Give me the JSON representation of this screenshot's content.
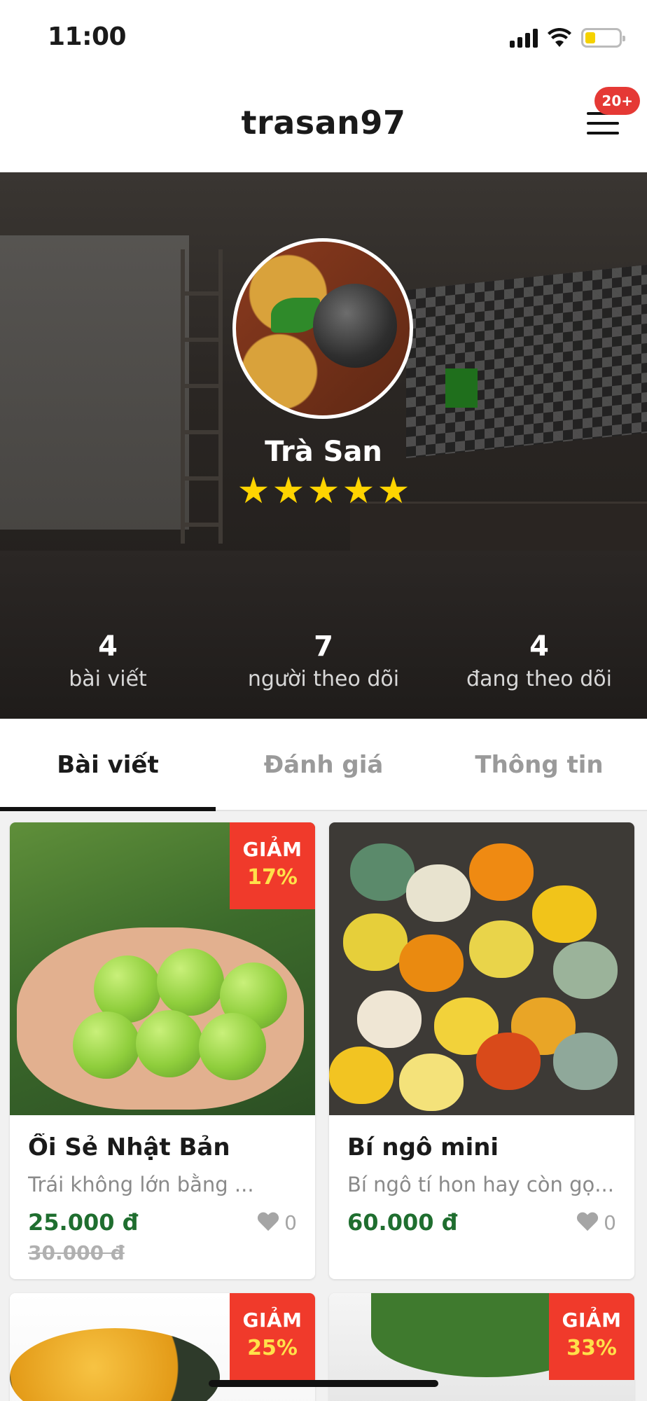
{
  "status_bar": {
    "time": "11:00",
    "battery_color": "#f5d200"
  },
  "header": {
    "title": "trasan97",
    "notification_badge": "20+",
    "menu_icon": "hamburger-icon"
  },
  "profile": {
    "name": "Trà San",
    "rating": 5,
    "rating_max": 5,
    "stats": [
      {
        "value": "4",
        "label": "bài viết"
      },
      {
        "value": "7",
        "label": "người theo dõi"
      },
      {
        "value": "4",
        "label": "đang theo dõi"
      }
    ]
  },
  "tabs": [
    {
      "label": "Bài viết",
      "active": true
    },
    {
      "label": "Đánh giá",
      "active": false
    },
    {
      "label": "Thông tin",
      "active": false
    }
  ],
  "products": [
    {
      "title": "Ổi Sẻ Nhật Bản",
      "description": "Trái không lớn bằng ...",
      "price": "25.000 đ",
      "old_price": "30.000 đ",
      "likes": "0",
      "discount_label": "GIẢM",
      "discount_value": "17%"
    },
    {
      "title": "Bí ngô mini",
      "description": "Bí ngô tí hon hay còn gọ...",
      "price": "60.000 đ",
      "old_price": "",
      "likes": "0"
    },
    {
      "discount_label": "GIẢM",
      "discount_value": "25%"
    },
    {
      "discount_label": "GIẢM",
      "discount_value": "33%"
    }
  ],
  "colors": {
    "price": "#1f6e2f",
    "discount_bg": "#f03a2b",
    "discount_value": "#ffe14a",
    "star": "#ffd400",
    "badge": "#e53935"
  }
}
